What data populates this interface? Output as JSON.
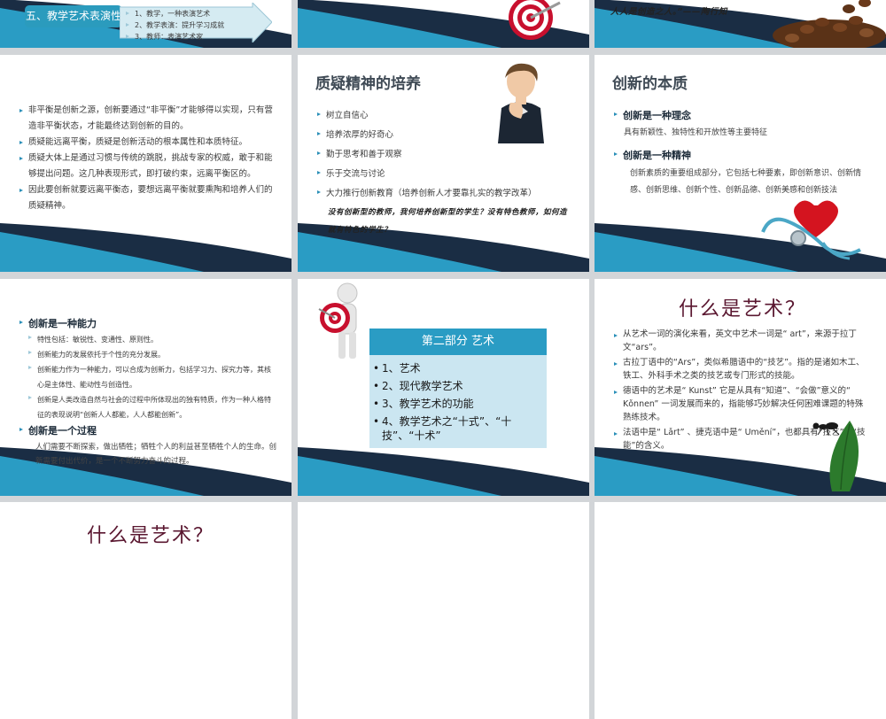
{
  "slide_top_left": {
    "title": "五、教学艺术表演性",
    "items": [
      "1、教学，一种表演艺术",
      "2、教学表演：提升学习成就",
      "3、教师：表演艺术家"
    ]
  },
  "slide_top_right": {
    "quote": "人人是创造之人。”——陶行知"
  },
  "slide_nonbalance": {
    "bullets": [
      "非平衡是创新之源，创新要通过“非平衡”才能够得以实现，只有营造非平衡状态，才能最终达到创新的目的。",
      "质疑能远离平衡，质疑是创新活动的根本属性和本质特征。",
      "质疑大体上是通过习惯与传统的跳脱，挑战专家的权威，敢于和能够提出问题。这几种表现形式，即打破约束，远离平衡区的。",
      "因此要创新就要远离平衡态，要想远离平衡就要熏陶和培养人们的质疑精神。"
    ]
  },
  "slide_question": {
    "title": "质疑精神的培养",
    "bullets": [
      "树立自信心",
      "培养浓厚的好奇心",
      "勤于思考和善于观察",
      "乐于交流与讨论",
      "大力推行创新教育（培养创新人才要靠扎实的教学改革）"
    ],
    "note": "没有创新型的教师，我何培养创新型的学生？没有特色教师，如何造就有特色的学生？"
  },
  "slide_essence": {
    "title": "创新的本质",
    "b1": "创新是一种理念",
    "d1": "具有新颖性、独特性和开放性等主要特征",
    "b2": "创新是一种精神",
    "d2": "创新素质的重要组成部分，它包括七种要素，即创新意识、创新情感、创新思维、创新个性、创新品德、创新美感和创新技法"
  },
  "slide_ability": {
    "b1": "创新是一种能力",
    "items1": [
      "特性包括：敏锐性、变通性、原则性。",
      "创新能力的发展依托于个性的充分发展。",
      "创新能力作为一种能力，可以合成为创新力，包括学习力、探究力等，其核心是主体性、能动性与创造性。",
      "创新是人类改造自然与社会的过程中所体现出的独有特质，作为一种人格特征的表现说明“创新人人都能，人人都能创新”。"
    ],
    "b2": "创新是一个过程",
    "d2": "人们需要不断探索，做出牺牲；牺牲个人的利益甚至牺牲个人的生命。创新需要付出代价，是一个不断努力奋斗的过程。"
  },
  "slide_part2": {
    "head": "第二部分 艺术",
    "items": [
      "1、艺术",
      "2、现代教学艺术",
      "3、教学艺术的功能",
      "4、教学艺术之“十式”、“十技”、“十术”"
    ]
  },
  "slide_art": {
    "title": "什么是艺术？",
    "bullets": [
      "从艺术一词的演化来看，英文中艺术一词是“ art”，来源于拉丁文“ars”。",
      "古拉丁语中的“Ars”，类似希腊语中的“技艺”。指的是诸如木工、铁工、外科手术之类的技艺或专门形式的技能。",
      "德语中的艺术是“ Kunst” 它是从具有“知道”、“会做”意义的“ Kǒnnen” 一词发展而来的，指能够巧妙解决任何困难课题的特殊熟练技术。",
      "法语中是“ Lǎrt” 、捷克语中是“ Umění”，也都具有“技艺”、“技能”的含义。"
    ]
  },
  "slide_bottom_left": {
    "title": "什么是艺术？"
  },
  "colors": {
    "teal": "#2a9cc4",
    "dark_navy": "#1b2a38",
    "maroon": "#5a1730"
  },
  "icons": [
    "target-icon",
    "coffee-beans-image",
    "thinking-man-image",
    "heart-stethoscope-image",
    "figure-target-image",
    "ant-on-leaf-image"
  ]
}
